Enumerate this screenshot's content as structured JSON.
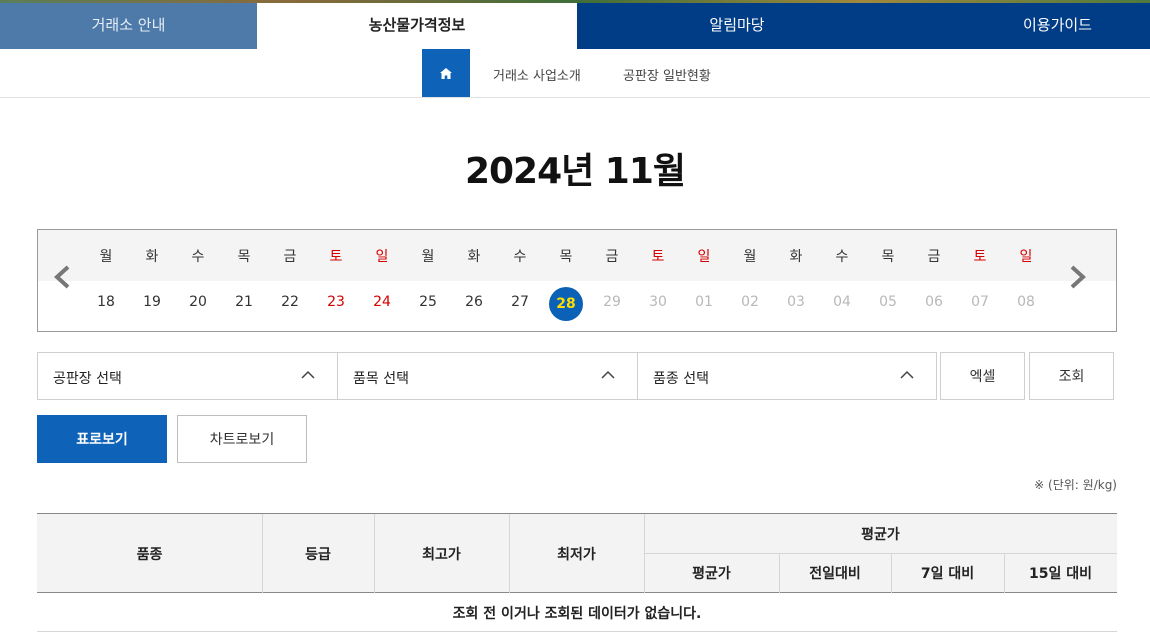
{
  "nav": {
    "tabs": [
      "거래소 안내",
      "농산물가격정보",
      "알림마당",
      "이용가이드"
    ],
    "active_tab": "농산물가격정보"
  },
  "subnav": {
    "home_icon": "home-icon",
    "links": [
      "거래소 사업소개",
      "공판장 일반현황"
    ]
  },
  "title": "2024년 11월",
  "calendar": {
    "days": [
      "월",
      "화",
      "수",
      "목",
      "금",
      "토",
      "일",
      "월",
      "화",
      "수",
      "목",
      "금",
      "토",
      "일",
      "월",
      "화",
      "수",
      "목",
      "금",
      "토",
      "일"
    ],
    "dates": [
      "18",
      "19",
      "20",
      "21",
      "22",
      "23",
      "24",
      "25",
      "26",
      "27",
      "28",
      "29",
      "30",
      "01",
      "02",
      "03",
      "04",
      "05",
      "06",
      "07",
      "08"
    ],
    "selected": "28",
    "weekend_color": "#d40000",
    "selected_color": "#0b61b5"
  },
  "filters": {
    "market": "공판장 선택",
    "item": "품목 선택",
    "variety": "품종 선택",
    "excel": "엑셀",
    "query": "조회"
  },
  "views": {
    "table": "표로보기",
    "chart": "차트로보기"
  },
  "unit": "※ (단위: 원/kg)",
  "table": {
    "headers": {
      "variety": "품종",
      "grade": "등급",
      "max": "최고가",
      "min": "최저가",
      "avg_group": "평균가",
      "avg": "평균가",
      "prev_day": "전일대비",
      "d7": "7일 대비",
      "d15": "15일 대비"
    },
    "empty_message": "조회 전 이거나 조회된 데이터가 없습니다."
  },
  "colors": {
    "brand_blue": "#0e63b8",
    "nav_dark": "#003d86",
    "nav_light": "#4d7aa8"
  }
}
